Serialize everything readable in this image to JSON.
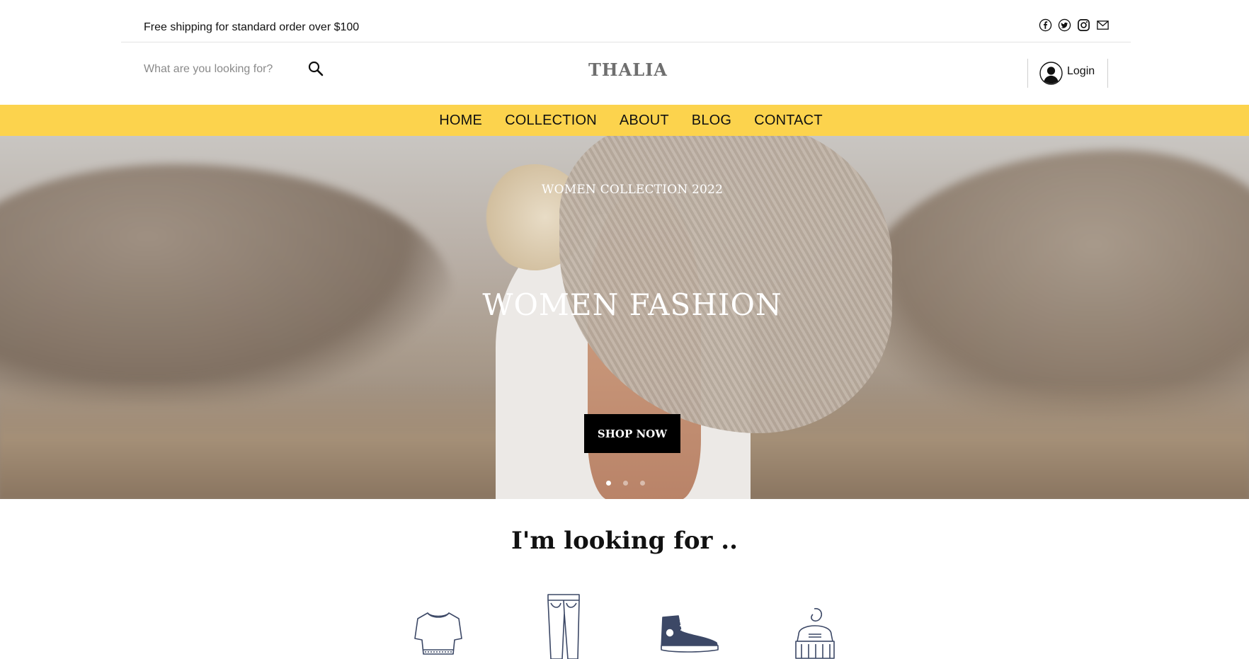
{
  "topbar": {
    "shipping_text": "Free shipping for standard order over $100",
    "social_icons": [
      "facebook-icon",
      "twitter-icon",
      "instagram-icon",
      "mail-icon"
    ]
  },
  "header": {
    "search_placeholder": "What are you looking for?",
    "search_icon": "search-icon",
    "logo": "THALIA",
    "login_label": "Login",
    "avatar_icon": "user-icon"
  },
  "nav": {
    "items": [
      "HOME",
      "COLLECTION",
      "ABOUT",
      "BLOG",
      "CONTACT"
    ]
  },
  "hero": {
    "subtitle": "WOMEN COLLECTION 2022",
    "title": "WOMEN FASHION",
    "cta_label": "SHOP NOW",
    "slides": 3,
    "active_slide": 1
  },
  "categories": {
    "heading": "I'm looking for ..",
    "icons": [
      "tshirt-icon",
      "jeans-icon",
      "sneaker-icon",
      "hat-icon"
    ]
  },
  "colors": {
    "nav_background": "#fcd34d",
    "cta_background": "#000000",
    "logo_text": "#6e6e6e"
  }
}
